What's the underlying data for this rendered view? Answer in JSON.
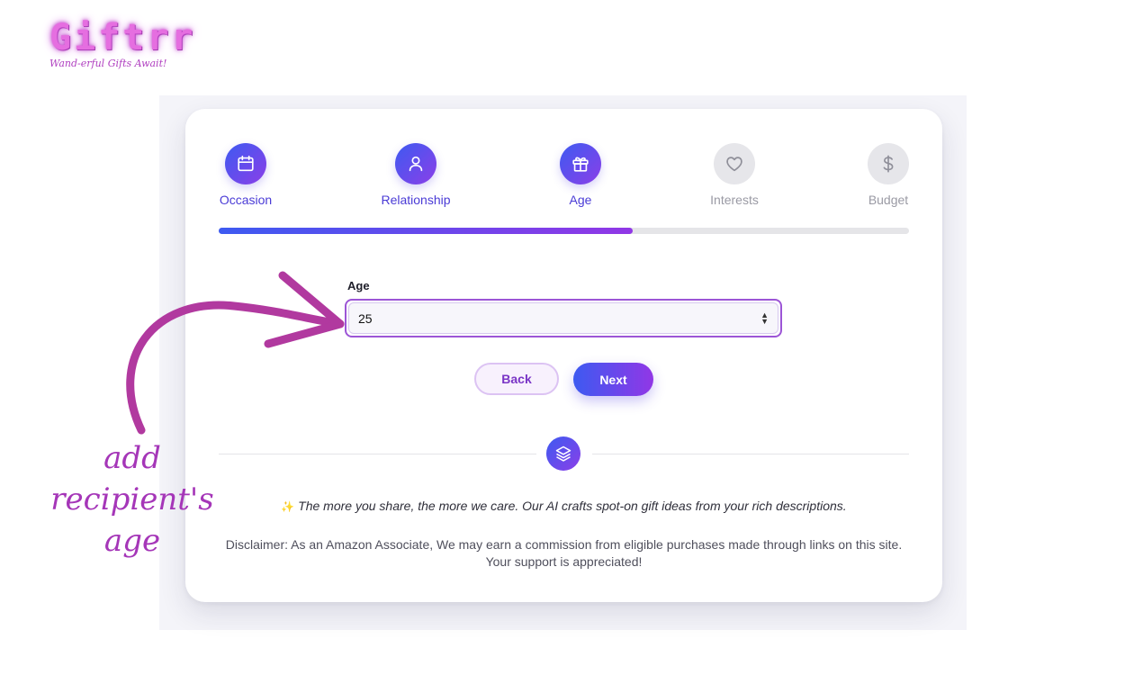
{
  "brand": {
    "name": "Giftrr",
    "tagline": "Wand-erful Gifts Await!"
  },
  "steps": [
    {
      "label": "Occasion",
      "icon": "calendar-icon",
      "state": "active"
    },
    {
      "label": "Relationship",
      "icon": "user-icon",
      "state": "active"
    },
    {
      "label": "Age",
      "icon": "gift-icon",
      "state": "active"
    },
    {
      "label": "Interests",
      "icon": "heart-icon",
      "state": "inactive"
    },
    {
      "label": "Budget",
      "icon": "dollar-icon",
      "state": "inactive"
    }
  ],
  "progress": {
    "percent": 60
  },
  "form": {
    "age_label": "Age",
    "age_value": "25"
  },
  "buttons": {
    "back": "Back",
    "next": "Next"
  },
  "divider": {
    "icon": "layers-icon"
  },
  "tagline": "The more you share, the more we care. Our AI crafts spot-on gift ideas from your rich descriptions.",
  "disclaimer": {
    "line1": "Disclaimer: As an Amazon Associate, We may earn a commission from eligible purchases made through links on this site.",
    "line2": "Your support is appreciated!"
  },
  "annotation": {
    "line1": "add recipient's",
    "line2": "age"
  },
  "colors": {
    "accent_start": "#3d5af1",
    "accent_end": "#9137e6",
    "annotation": "#a536b8",
    "logo": "#e56ee0"
  }
}
